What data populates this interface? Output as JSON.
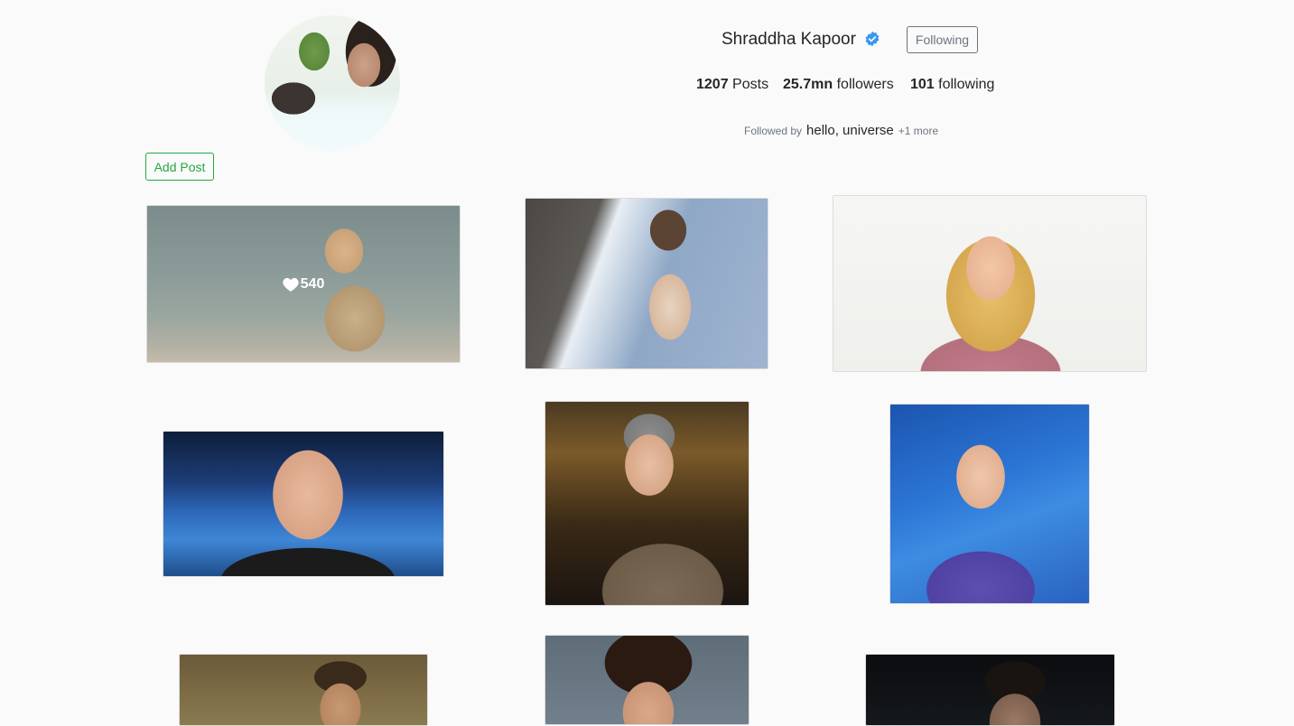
{
  "profile": {
    "name": "Shraddha Kapoor",
    "verified_icon": "verified-badge-icon",
    "follow_button_label": "Following",
    "stats": {
      "posts_count": "1207",
      "posts_label": "Posts",
      "followers_count": "25.7mn",
      "followers_label": "followers",
      "following_count": "101",
      "following_label": "following"
    },
    "followed_by": {
      "label": "Followed by",
      "name": "hello, universe",
      "more": "+1 more"
    }
  },
  "actions": {
    "add_post_label": "Add Post"
  },
  "posts": [
    {
      "likes": "540",
      "like_icon": "heart-icon"
    }
  ],
  "colors": {
    "background": "#fafafa",
    "verified_blue": "#3897f0",
    "add_post_green": "#28a745",
    "following_gray": "#6c757d"
  }
}
